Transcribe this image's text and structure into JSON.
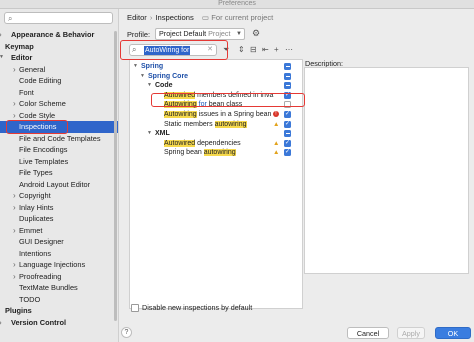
{
  "window": {
    "title": "Preferences"
  },
  "sidebar": {
    "search_placeholder": "",
    "items": [
      {
        "label": "Appearance & Behavior",
        "bold": true,
        "expanded": false
      },
      {
        "label": "Keymap",
        "bold": true
      },
      {
        "label": "Editor",
        "bold": true,
        "expanded": true
      },
      {
        "label": "General",
        "expandable": true
      },
      {
        "label": "Code Editing"
      },
      {
        "label": "Font"
      },
      {
        "label": "Color Scheme",
        "expandable": true
      },
      {
        "label": "Code Style",
        "expandable": true
      },
      {
        "label": "Inspections",
        "selected": true
      },
      {
        "label": "File and Code Templates"
      },
      {
        "label": "File Encodings"
      },
      {
        "label": "Live Templates"
      },
      {
        "label": "File Types"
      },
      {
        "label": "Android Layout Editor"
      },
      {
        "label": "Copyright",
        "expandable": true
      },
      {
        "label": "Inlay Hints",
        "expandable": true
      },
      {
        "label": "Duplicates"
      },
      {
        "label": "Emmet",
        "expandable": true
      },
      {
        "label": "GUI Designer"
      },
      {
        "label": "Intentions"
      },
      {
        "label": "Language Injections",
        "expandable": true
      },
      {
        "label": "Proofreading",
        "expandable": true
      },
      {
        "label": "TextMate Bundles"
      },
      {
        "label": "TODO"
      },
      {
        "label": "Plugins",
        "bold": true
      },
      {
        "label": "Version Control",
        "bold": true,
        "expandable": true
      }
    ]
  },
  "header": {
    "breadcrumb_root": "Editor",
    "breadcrumb_separator": "›",
    "breadcrumb_current": "Inspections",
    "scope_hint": "For current project",
    "profile_label": "Profile:",
    "profile_value": "Project Default",
    "profile_scope": "Project"
  },
  "inspection_search": {
    "value": "AutoWiring for"
  },
  "inspections": [
    {
      "label": "Spring",
      "level": 0,
      "arrow": "▼",
      "style": "bl",
      "check": "dash"
    },
    {
      "label": "Spring Core",
      "level": 1,
      "arrow": "▼",
      "style": "bl",
      "check": "dash"
    },
    {
      "label": "Code",
      "level": 2,
      "arrow": "▼",
      "style": "bold",
      "check": "dash"
    },
    {
      "hl": "Autowired",
      "rest": " members defined in inva",
      "level": 3,
      "severity": "",
      "check": "check"
    },
    {
      "hl": "Autowiring",
      "blue": " for",
      "rest": " bean class",
      "level": 3,
      "severity": "",
      "check": "empty"
    },
    {
      "hl": "Autowiring",
      "rest": " issues in a Spring bean",
      "level": 3,
      "severity": "err",
      "check": "check"
    },
    {
      "pre": "Static members ",
      "hl": "autowiring",
      "rest": "",
      "level": 3,
      "severity": "warn",
      "check": "check"
    },
    {
      "label": "XML",
      "level": 2,
      "arrow": "▼",
      "style": "bold",
      "check": "dash"
    },
    {
      "hl": "Autowired",
      "rest": " dependencies",
      "level": 3,
      "severity": "warn",
      "check": "check"
    },
    {
      "pre": "Spring bean ",
      "hl": "autowiring",
      "rest": "",
      "level": 3,
      "severity": "warn",
      "check": "check"
    }
  ],
  "description_label": "Description:",
  "footer": {
    "disable_new_label": "Disable new inspections by default",
    "help": "?",
    "cancel": "Cancel",
    "apply": "Apply",
    "ok": "OK"
  },
  "colors": {
    "accent": "#2f65ca",
    "highlight": "#f6d94c",
    "annotation_red": "#e53935"
  }
}
